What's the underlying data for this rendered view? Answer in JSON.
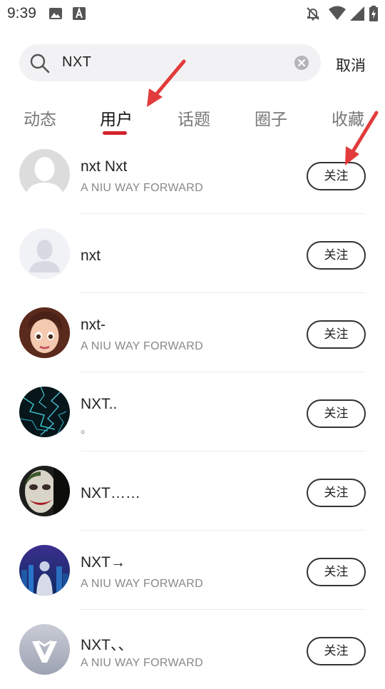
{
  "status_bar": {
    "time": "9:39",
    "icons": [
      "image-icon",
      "a-badge-icon",
      "bell-off-icon",
      "wifi-icon",
      "signal-icon",
      "battery-charging-icon"
    ]
  },
  "search": {
    "query": "NXT",
    "cancel_label": "取消",
    "icons": {
      "search": "search-icon",
      "clear": "clear-icon"
    }
  },
  "tabs": [
    {
      "label": "动态",
      "active": false
    },
    {
      "label": "用户",
      "active": true
    },
    {
      "label": "话题",
      "active": false
    },
    {
      "label": "圈子",
      "active": false
    },
    {
      "label": "收藏",
      "active": false
    }
  ],
  "accent_color": "#d3222b",
  "users": [
    {
      "name": "nxt Nxt",
      "subtitle": "A NIU WAY FORWARD",
      "follow_label": "关注",
      "avatar": "default-silhouette-avatar"
    },
    {
      "name": "nxt",
      "subtitle": "",
      "follow_label": "关注",
      "avatar": "default-person-avatar"
    },
    {
      "name": "nxt-",
      "subtitle": "A NIU WAY FORWARD",
      "follow_label": "关注",
      "avatar": "cartoon-girl-avatar"
    },
    {
      "name": "NXT..",
      "subtitle": "。",
      "follow_label": "关注",
      "avatar": "lightning-avatar"
    },
    {
      "name": "NXT……",
      "subtitle": "",
      "follow_label": "关注",
      "avatar": "joker-avatar"
    },
    {
      "name": "NXT→",
      "subtitle": "A NIU WAY FORWARD",
      "follow_label": "关注",
      "avatar": "city-night-avatar"
    },
    {
      "name": "NXT、、",
      "subtitle": "A NIU WAY FORWARD",
      "follow_label": "关注",
      "avatar": "niu-logo-avatar"
    }
  ]
}
